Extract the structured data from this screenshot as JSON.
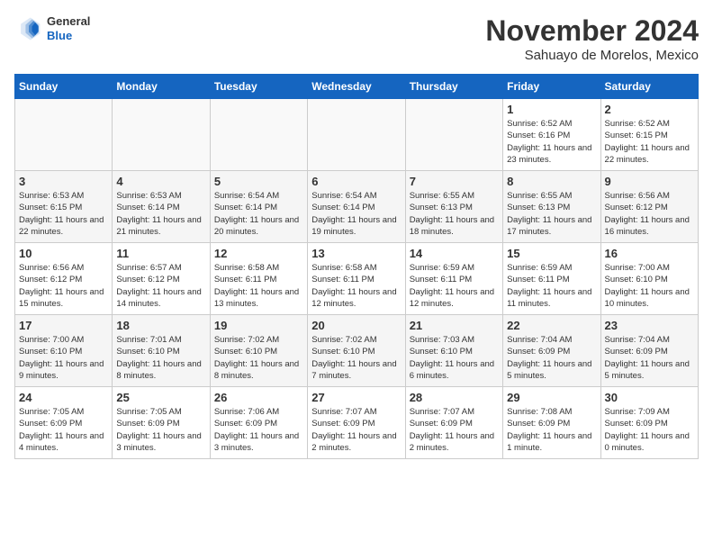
{
  "header": {
    "logo_line1": "General",
    "logo_line2": "Blue",
    "month": "November 2024",
    "location": "Sahuayo de Morelos, Mexico"
  },
  "weekdays": [
    "Sunday",
    "Monday",
    "Tuesday",
    "Wednesday",
    "Thursday",
    "Friday",
    "Saturday"
  ],
  "weeks": [
    [
      {
        "day": "",
        "info": ""
      },
      {
        "day": "",
        "info": ""
      },
      {
        "day": "",
        "info": ""
      },
      {
        "day": "",
        "info": ""
      },
      {
        "day": "",
        "info": ""
      },
      {
        "day": "1",
        "info": "Sunrise: 6:52 AM\nSunset: 6:16 PM\nDaylight: 11 hours and 23 minutes."
      },
      {
        "day": "2",
        "info": "Sunrise: 6:52 AM\nSunset: 6:15 PM\nDaylight: 11 hours and 22 minutes."
      }
    ],
    [
      {
        "day": "3",
        "info": "Sunrise: 6:53 AM\nSunset: 6:15 PM\nDaylight: 11 hours and 22 minutes."
      },
      {
        "day": "4",
        "info": "Sunrise: 6:53 AM\nSunset: 6:14 PM\nDaylight: 11 hours and 21 minutes."
      },
      {
        "day": "5",
        "info": "Sunrise: 6:54 AM\nSunset: 6:14 PM\nDaylight: 11 hours and 20 minutes."
      },
      {
        "day": "6",
        "info": "Sunrise: 6:54 AM\nSunset: 6:14 PM\nDaylight: 11 hours and 19 minutes."
      },
      {
        "day": "7",
        "info": "Sunrise: 6:55 AM\nSunset: 6:13 PM\nDaylight: 11 hours and 18 minutes."
      },
      {
        "day": "8",
        "info": "Sunrise: 6:55 AM\nSunset: 6:13 PM\nDaylight: 11 hours and 17 minutes."
      },
      {
        "day": "9",
        "info": "Sunrise: 6:56 AM\nSunset: 6:12 PM\nDaylight: 11 hours and 16 minutes."
      }
    ],
    [
      {
        "day": "10",
        "info": "Sunrise: 6:56 AM\nSunset: 6:12 PM\nDaylight: 11 hours and 15 minutes."
      },
      {
        "day": "11",
        "info": "Sunrise: 6:57 AM\nSunset: 6:12 PM\nDaylight: 11 hours and 14 minutes."
      },
      {
        "day": "12",
        "info": "Sunrise: 6:58 AM\nSunset: 6:11 PM\nDaylight: 11 hours and 13 minutes."
      },
      {
        "day": "13",
        "info": "Sunrise: 6:58 AM\nSunset: 6:11 PM\nDaylight: 11 hours and 12 minutes."
      },
      {
        "day": "14",
        "info": "Sunrise: 6:59 AM\nSunset: 6:11 PM\nDaylight: 11 hours and 12 minutes."
      },
      {
        "day": "15",
        "info": "Sunrise: 6:59 AM\nSunset: 6:11 PM\nDaylight: 11 hours and 11 minutes."
      },
      {
        "day": "16",
        "info": "Sunrise: 7:00 AM\nSunset: 6:10 PM\nDaylight: 11 hours and 10 minutes."
      }
    ],
    [
      {
        "day": "17",
        "info": "Sunrise: 7:00 AM\nSunset: 6:10 PM\nDaylight: 11 hours and 9 minutes."
      },
      {
        "day": "18",
        "info": "Sunrise: 7:01 AM\nSunset: 6:10 PM\nDaylight: 11 hours and 8 minutes."
      },
      {
        "day": "19",
        "info": "Sunrise: 7:02 AM\nSunset: 6:10 PM\nDaylight: 11 hours and 8 minutes."
      },
      {
        "day": "20",
        "info": "Sunrise: 7:02 AM\nSunset: 6:10 PM\nDaylight: 11 hours and 7 minutes."
      },
      {
        "day": "21",
        "info": "Sunrise: 7:03 AM\nSunset: 6:10 PM\nDaylight: 11 hours and 6 minutes."
      },
      {
        "day": "22",
        "info": "Sunrise: 7:04 AM\nSunset: 6:09 PM\nDaylight: 11 hours and 5 minutes."
      },
      {
        "day": "23",
        "info": "Sunrise: 7:04 AM\nSunset: 6:09 PM\nDaylight: 11 hours and 5 minutes."
      }
    ],
    [
      {
        "day": "24",
        "info": "Sunrise: 7:05 AM\nSunset: 6:09 PM\nDaylight: 11 hours and 4 minutes."
      },
      {
        "day": "25",
        "info": "Sunrise: 7:05 AM\nSunset: 6:09 PM\nDaylight: 11 hours and 3 minutes."
      },
      {
        "day": "26",
        "info": "Sunrise: 7:06 AM\nSunset: 6:09 PM\nDaylight: 11 hours and 3 minutes."
      },
      {
        "day": "27",
        "info": "Sunrise: 7:07 AM\nSunset: 6:09 PM\nDaylight: 11 hours and 2 minutes."
      },
      {
        "day": "28",
        "info": "Sunrise: 7:07 AM\nSunset: 6:09 PM\nDaylight: 11 hours and 2 minutes."
      },
      {
        "day": "29",
        "info": "Sunrise: 7:08 AM\nSunset: 6:09 PM\nDaylight: 11 hours and 1 minute."
      },
      {
        "day": "30",
        "info": "Sunrise: 7:09 AM\nSunset: 6:09 PM\nDaylight: 11 hours and 0 minutes."
      }
    ]
  ]
}
